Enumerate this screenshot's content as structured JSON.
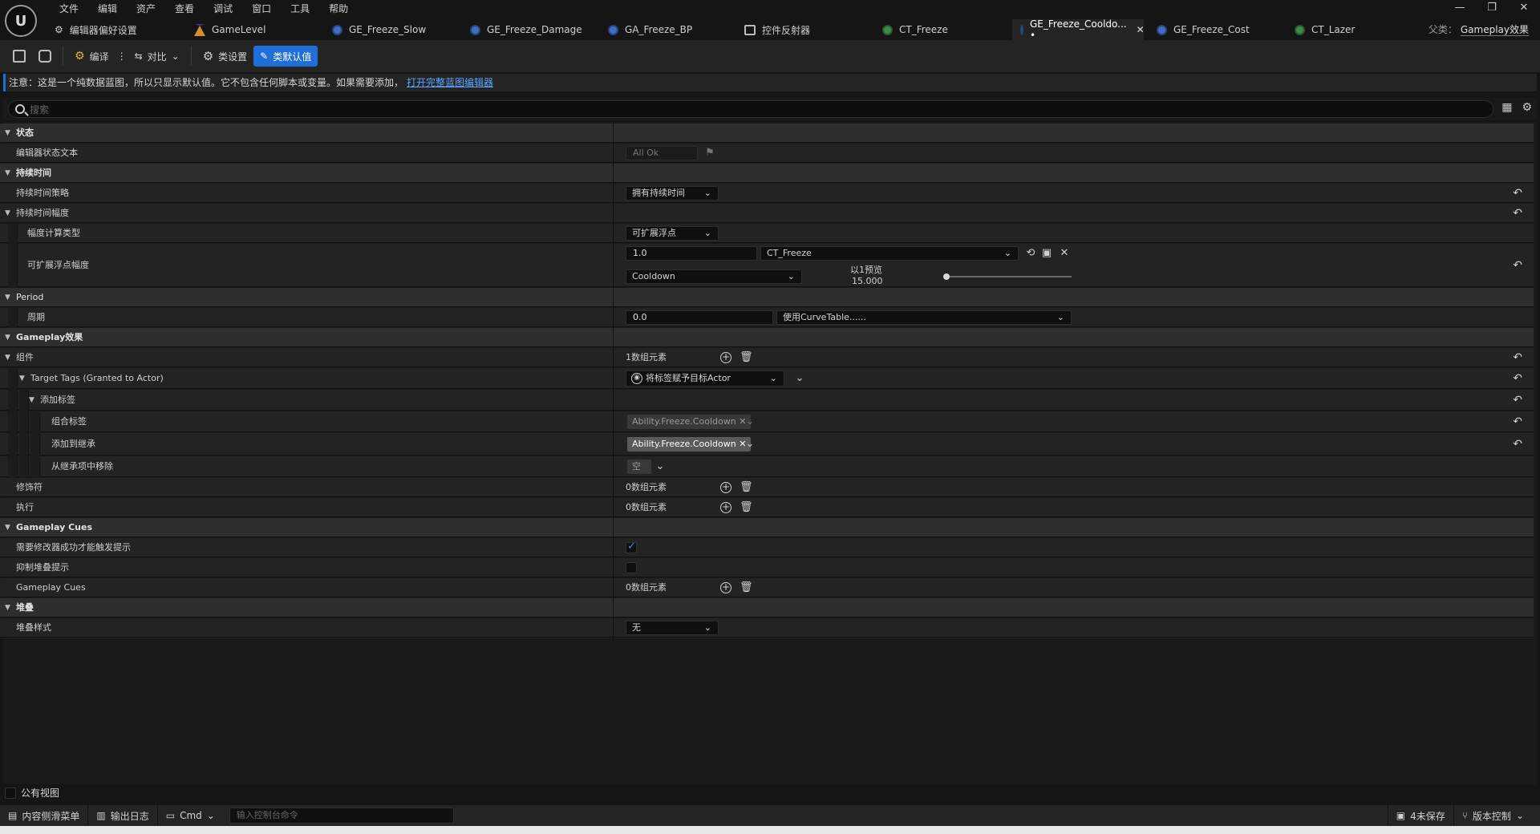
{
  "menu": [
    "文件",
    "编辑",
    "资产",
    "查看",
    "调试",
    "窗口",
    "工具",
    "帮助"
  ],
  "window_controls": [
    "—",
    "❐",
    "✕"
  ],
  "tabs": [
    {
      "label": "编辑器偏好设置",
      "icon": "settings-sliders-icon"
    },
    {
      "label": "GameLevel",
      "icon": "level-icon"
    },
    {
      "label": "GE_Freeze_Slow",
      "icon": "blueprint-icon"
    },
    {
      "label": "GE_Freeze_Damage",
      "icon": "blueprint-icon"
    },
    {
      "label": "GA_Freeze_BP",
      "icon": "blueprint-icon"
    },
    {
      "label": "控件反射器",
      "icon": "widget-reflector-icon"
    },
    {
      "label": "CT_Freeze",
      "icon": "curve-table-icon"
    },
    {
      "label": "GE_Freeze_Cooldo... •",
      "icon": "blueprint-icon",
      "active": true
    },
    {
      "label": "GE_Freeze_Cost",
      "icon": "blueprint-icon"
    },
    {
      "label": "CT_Lazer",
      "icon": "curve-table-icon"
    }
  ],
  "parent": {
    "prefix": "父类：",
    "value": "Gameplay效果"
  },
  "toolbar": {
    "compile": "编译",
    "diff": "对比",
    "class_settings": "类设置",
    "class_defaults": "类默认值"
  },
  "notice": {
    "text": "注意：这是一个纯数据蓝图，所以只显示默认值。它不包含任何脚本或变量。如果需要添加，",
    "link": "打开完整蓝图编辑器"
  },
  "search": {
    "placeholder": "搜索"
  },
  "details": {
    "cat_status": "状态",
    "editor_status_text": "编辑器状态文本",
    "editor_status_value": "All Ok",
    "cat_duration": "持续时间",
    "duration_policy": "持续时间策略",
    "duration_policy_value": "拥有持续时间",
    "duration_magnitude": "持续时间幅度",
    "magnitude_calc_type": "幅度计算类型",
    "magnitude_calc_value": "可扩展浮点",
    "scalable_float": "可扩展浮点幅度",
    "scalable_value": "1.0",
    "curve_table": "CT_Freeze",
    "curve_row": "Cooldown",
    "preview_label": "以1预览",
    "preview_value": "15.000",
    "cat_period": "Period",
    "period": "周期",
    "period_value": "0.0",
    "period_curve": "使用CurveTable......",
    "cat_gameplay_effect": "Gameplay效果",
    "components": "组件",
    "components_count": "1数组元素",
    "target_tags": "Target Tags (Granted to Actor)",
    "target_tags_value": "将标签赋予目标Actor",
    "add_tags": "添加标签",
    "combined_tags": "组合标签",
    "combined_tag_value": "Ability.Freeze.Cooldown",
    "add_to_inherited": "添加到继承",
    "added_tag_value": "Ability.Freeze.Cooldown",
    "remove_inherited": "从继承项中移除",
    "remove_value": "空",
    "modifiers": "修饰符",
    "modifiers_count": "0数组元素",
    "executions": "执行",
    "executions_count": "0数组元素",
    "cat_gameplay_cues": "Gameplay Cues",
    "require_modifier_success": "需要修改器成功才能触发提示",
    "suppress_stacking_cues": "抑制堆叠提示",
    "gameplay_cues": "Gameplay Cues",
    "gameplay_cues_count": "0数组元素",
    "cat_stacking": "堆叠",
    "stacking_type": "堆叠样式",
    "stacking_value": "无"
  },
  "public_view": "公有视图",
  "statusbar": {
    "content_drawer": "内容侧滑菜单",
    "output_log": "输出日志",
    "cmd": "Cmd",
    "cmd_placeholder": "输入控制台命令",
    "unsaved": "4未保存",
    "source_control": "版本控制"
  },
  "colors": {
    "accent": "#1f6fd6",
    "link": "#58a6ff",
    "checkbox": "#3a8cf6"
  }
}
